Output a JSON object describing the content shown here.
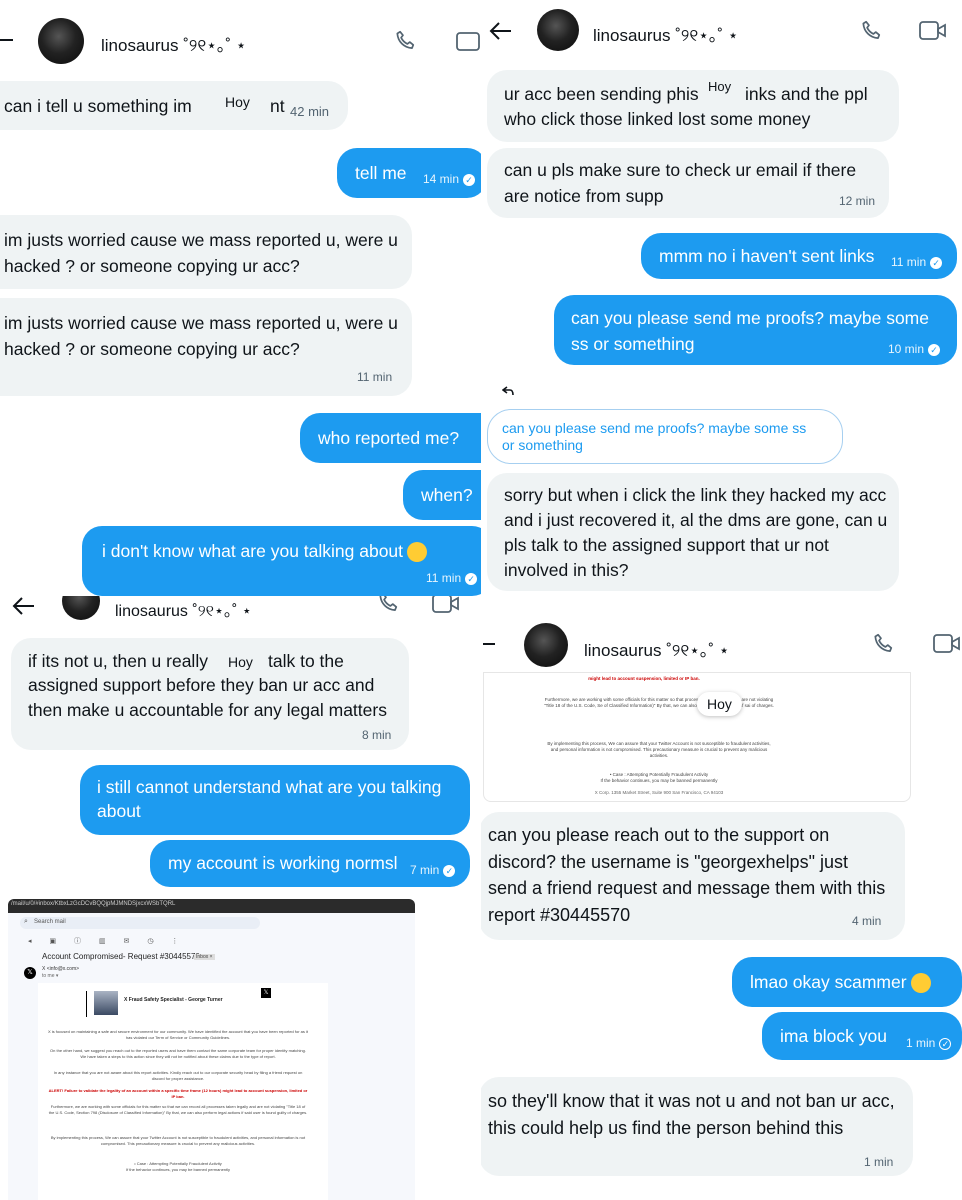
{
  "contact_name": "linosaurus ˚୨୧⋆｡˚ ⋆",
  "reaction_label": "Hoy",
  "panel1": {
    "messages": [
      {
        "text": "can i tell u something im",
        "suffix": "nt",
        "time": "42 min"
      },
      {
        "text": "tell me",
        "time": "14 min"
      },
      {
        "text": "im justs worried cause we mass reported u, were u hacked ? or someone copying ur acc?"
      },
      {
        "text": "im justs worried cause we mass reported u, were u hacked ? or someone copying ur acc?",
        "time": "11 min"
      },
      {
        "text": "who reported me?"
      },
      {
        "text": "when?"
      },
      {
        "text": "i don't know what are you talking about",
        "time": "11 min"
      }
    ]
  },
  "panel2": {
    "messages": [
      {
        "text_a": "ur acc been sending phis",
        "text_b": "inks  and the ppl",
        "text_c": "who click those linked lost some money"
      },
      {
        "text": "can u pls  make sure to check ur email if there are notice from supp",
        "time": "12 min"
      },
      {
        "text": "mmm no i haven't sent links",
        "time": "11 min"
      },
      {
        "text": "can you please send me proofs? maybe some ss or something",
        "time": "10 min"
      },
      {
        "quote": "can you please send me proofs? maybe some ss or something"
      },
      {
        "text": "sorry but when i click the link they hacked my acc and i just recovered it, al the dms are gone, can u pls talk to the assigned support that ur not involved in this?"
      }
    ]
  },
  "panel3": {
    "messages": [
      {
        "text_a": "if its not u, then u really",
        "text_b": "talk to the",
        "text_c": "assigned support before they ban ur acc and then make u accountable for any legal matters",
        "time": "8 min"
      },
      {
        "text": "i still cannot understand what are you talking about"
      },
      {
        "text": "my account is working normsl",
        "time": "7 min"
      }
    ],
    "email": {
      "url": "/mail/u/0/#inbox/KtbxLzGcDCvBQQjpMJMNDSjxcxWSbTQRL",
      "search_placeholder": "Search mail",
      "subject": "Account Compromised- Request #30445570",
      "inbox_tag": "Inbox ×",
      "sender": "X <info@x.com>",
      "to": "to me ▾",
      "signature": "X Fraud Safety Specialist - George Turner",
      "para1": "X is focused on maintaining a safe and secure environment for our community. We have identified the account that you have been reported for as it has violated our Term of Service or Community Guidelines.",
      "para2": "On the other hand, we suggest you reach out to the reported users and have them contact the same corporate team for proper identity matching. We have taken a steps to this action since they will not be notified about these claims due to the type of report.",
      "para3": "In any instance that you are not aware about this report activities. Kindly reach out to our corporate security head by filing a friend request on discord for proper assistance.",
      "alert": "ALERT! Failure to validate the legality of an account within a specific time frame (12 hours) might lead to account suspension, limited or IP ban.",
      "para4": "Furthermore, we are working with some officials for this matter so that we can record all processes taken legally and are not violating \"Title 18 of the U.S. Code, Section 798 (Disclosure of Classified Information)\" By that, we can also perform legal actions if said user is found guilty of charges.",
      "para5": "By implementing this process, We can assure that your Twitter Account is not susceptible to fraudulent activities, and personal information is not compromised. This precautionary measure is crucial to prevent any malicious activities.",
      "case": "• Case : Attempting Potentially Fraudulent Activity",
      "case2": "If the behavior continues, you may be banned permanently"
    }
  },
  "panel4": {
    "doc_alert": "might lead to account suspension, limited or IP ban.",
    "doc_para4": "Furthermore, we are working with some officials for this matter so that processes taken legally and are not violating \"Title 18 of the U.S. Code, Se of Classified Information)\" By that, we can also perform legal actions if sai of charges.",
    "doc_para5": "By implementing this process, We can assure that your Twitter Account is not susceptible to fraudulent activities, and personal information is not compromised. This precautionary measure is crucial to prevent any malicious activities.",
    "doc_case": "• Case : Attempting Potentially Fraudulent Activity",
    "doc_case2": "If the behavior continues, you may be banned permanently",
    "doc_address": "X Corp. 1355 Market Street, Suite 900 San Francisco, CA 94103",
    "messages": [
      {
        "text": "can you please reach out to the support on discord? the username is \"georgexhelps\" just send a friend request and message them with this report #30445570",
        "time": "4 min"
      },
      {
        "text": "lmao okay scammer"
      },
      {
        "text": "ima block you",
        "time": "1 min"
      },
      {
        "text": "so they'll know that it was not u and not ban ur acc, this could help us find the person behind this",
        "time": "1 min"
      }
    ]
  }
}
